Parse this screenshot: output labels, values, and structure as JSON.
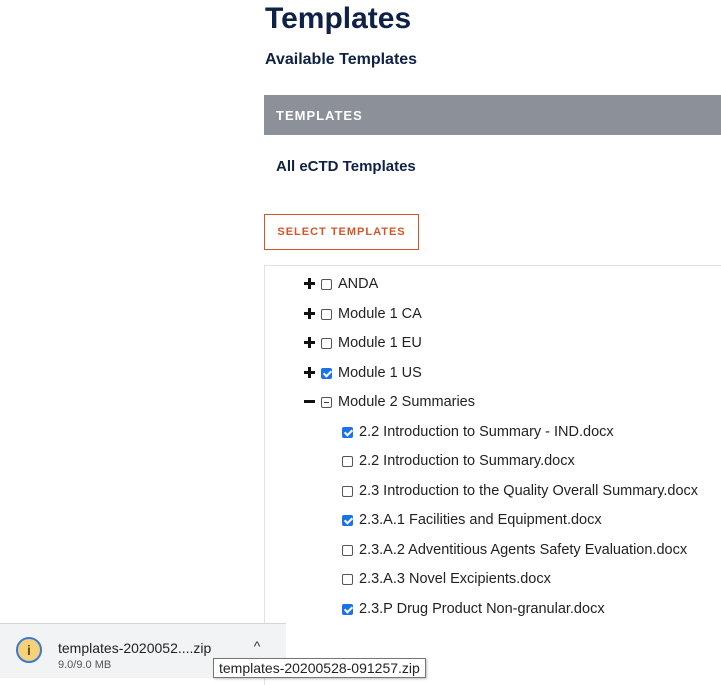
{
  "page": {
    "title": "Templates",
    "subtitle": "Available Templates"
  },
  "section": {
    "label": "TEMPLATES",
    "all_label": "All eCTD Templates"
  },
  "select_button": {
    "label": "SELECT TEMPLATES"
  },
  "tree": {
    "items": [
      {
        "label": "ANDA",
        "state": "unchecked",
        "expander": "plus"
      },
      {
        "label": "Module 1 CA",
        "state": "unchecked",
        "expander": "plus"
      },
      {
        "label": "Module 1 EU",
        "state": "unchecked",
        "expander": "plus"
      },
      {
        "label": "Module 1 US",
        "state": "checked",
        "expander": "plus"
      },
      {
        "label": "Module 2 Summaries",
        "state": "partial",
        "expander": "minus",
        "children": [
          {
            "label": "2.2 Introduction to Summary - IND.docx",
            "state": "checked"
          },
          {
            "label": "2.2 Introduction to Summary.docx",
            "state": "unchecked"
          },
          {
            "label": "2.3 Introduction to the Quality Overall Summary.docx",
            "state": "unchecked"
          },
          {
            "label": "2.3.A.1 Facilities and Equipment.docx",
            "state": "checked"
          },
          {
            "label": "2.3.A.2 Adventitious Agents Safety Evaluation.docx",
            "state": "unchecked"
          },
          {
            "label": "2.3.A.3 Novel Excipients.docx",
            "state": "unchecked"
          },
          {
            "label": "2.3.P Drug Product Non-granular.docx",
            "state": "checked"
          }
        ]
      }
    ]
  },
  "download": {
    "filename": "templates-2020052....zip",
    "size": "9.0/9.0 MB",
    "tooltip": "templates-20200528-091257.zip",
    "caret": "^"
  },
  "colors": {
    "title": "#0f2147",
    "section_bar": "#8c9099",
    "accent": "#d0562a",
    "checkbox": "#1a73e8"
  }
}
